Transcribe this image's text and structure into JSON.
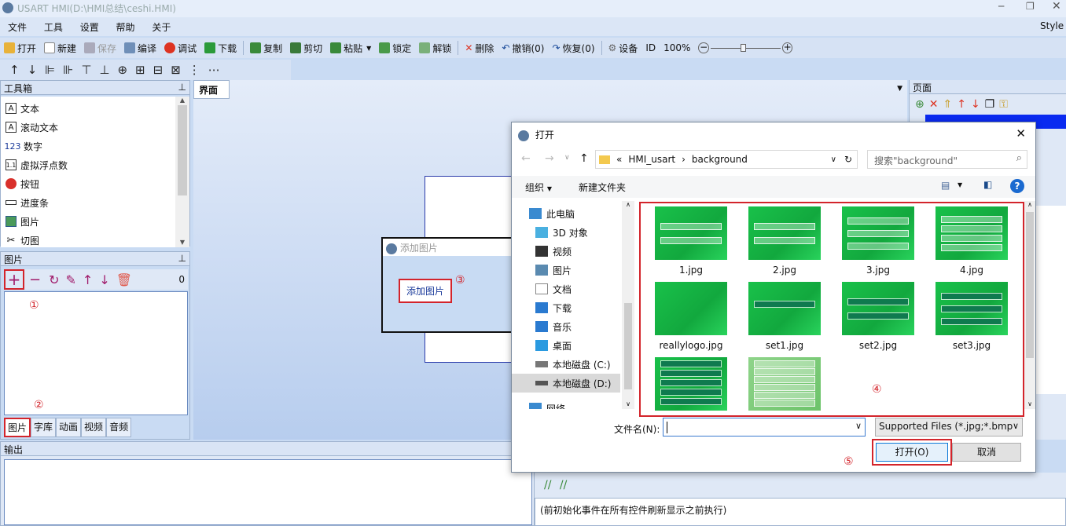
{
  "window": {
    "title": "USART  HMI(D:\\HMI总结\\ceshi.HMI)",
    "style": "Style"
  },
  "menu": [
    "文件",
    "工具",
    "设置",
    "帮助",
    "关于"
  ],
  "toolbar1": {
    "open": "打开",
    "new": "新建",
    "save": "保存",
    "compile": "编译",
    "debug": "调试",
    "download": "下载",
    "copy": "复制",
    "cut": "剪切",
    "paste": "粘贴",
    "lock": "锁定",
    "unlock": "解锁",
    "delete": "删除",
    "undo": "撤销(0)",
    "redo": "恢复(0)",
    "device": "设备",
    "id": "ID",
    "zoom": "100%"
  },
  "toolbox": {
    "title": "工具箱",
    "items": [
      "文本",
      "滚动文本",
      "数字",
      "虚拟浮点数",
      "按钮",
      "进度条",
      "图片",
      "切图"
    ],
    "glyphs": [
      "A",
      "A",
      "123",
      "1.1",
      "",
      "",
      "",
      ""
    ]
  },
  "pictures": {
    "title": "图片",
    "count": "0",
    "marker1": "①",
    "marker2": "②",
    "tabs": [
      "图片",
      "字库",
      "动画",
      "视频",
      "音频"
    ]
  },
  "canvas": {
    "tab": "界面"
  },
  "add_picture": {
    "title": "添加图片",
    "button": "添加图片",
    "marker": "③"
  },
  "right_panel": {
    "title": "页面"
  },
  "output": {
    "title": "输出",
    "event_text": "(前初始化事件在所有控件刷新显示之前执行)"
  },
  "dialog": {
    "title": "打开",
    "path": [
      "«",
      "HMI_usart",
      "›",
      "background"
    ],
    "search_placeholder": "搜索\"background\"",
    "organize": "组织",
    "new_folder": "新建文件夹",
    "nav": [
      "此电脑",
      "3D 对象",
      "视频",
      "图片",
      "文档",
      "下载",
      "音乐",
      "桌面",
      "本地磁盘 (C:)",
      "本地磁盘 (D:)",
      "网络"
    ],
    "files": [
      {
        "name": "1.jpg",
        "bars": 2,
        "dark": false
      },
      {
        "name": "2.jpg",
        "bars": 2,
        "dark": false
      },
      {
        "name": "3.jpg",
        "bars": 3,
        "dark": false
      },
      {
        "name": "4.jpg",
        "bars": 4,
        "dark": false
      },
      {
        "name": "reallylogo.jpg",
        "bars": 0,
        "dark": false
      },
      {
        "name": "set1.jpg",
        "bars": 1,
        "dark": true
      },
      {
        "name": "set2.jpg",
        "bars": 2,
        "dark": true
      },
      {
        "name": "set3.jpg",
        "bars": 3,
        "dark": true
      },
      {
        "name": "",
        "bars": 5,
        "dark": true
      },
      {
        "name": "",
        "bars": 6,
        "dark": false
      }
    ],
    "marker4": "④",
    "filename_label": "文件名(N):",
    "filename_value": "",
    "filter": "Supported Files (*.jpg;*.bmp",
    "open": "打开(O)",
    "cancel": "取消",
    "marker5": "⑤"
  }
}
